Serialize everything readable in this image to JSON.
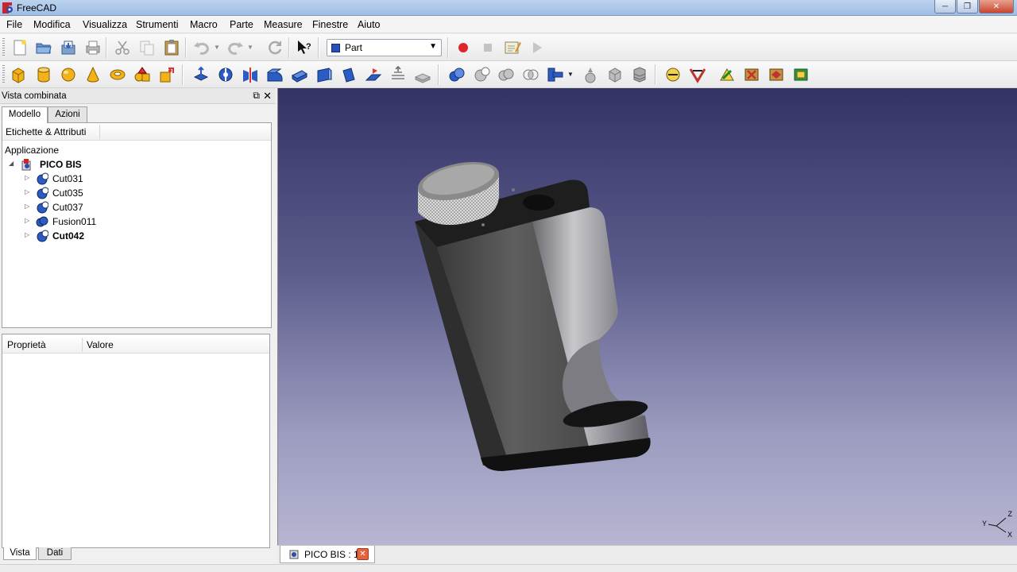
{
  "window": {
    "title": "FreeCAD"
  },
  "menu": [
    "File",
    "Modifica",
    "Visualizza",
    "Strumenti",
    "Macro",
    "Parte",
    "Measure",
    "Finestre",
    "Aiuto"
  ],
  "toolbar": {
    "workbench_selected": "Part"
  },
  "dock": {
    "title": "Vista combinata",
    "tabs": [
      "Modello",
      "Azioni"
    ],
    "tree_header": "Etichette & Attributi",
    "root_label": "Applicazione",
    "document": "PICO BIS",
    "objects": [
      {
        "label": "Cut031",
        "bold": false
      },
      {
        "label": "Cut035",
        "bold": false
      },
      {
        "label": "Cut037",
        "bold": false
      },
      {
        "label": "Fusion011",
        "bold": false
      },
      {
        "label": "Cut042",
        "bold": true
      }
    ],
    "property_columns": [
      "Proprietà",
      "Valore"
    ],
    "bottom_tabs": [
      "Vista",
      "Dati"
    ]
  },
  "view": {
    "axis_labels": {
      "x": "X",
      "y": "Y",
      "z": "Z"
    }
  },
  "document_tab": {
    "label": "PICO BIS : 1"
  },
  "colors": {
    "view_top": "#333366",
    "view_bottom": "#b6b6d2",
    "model_body": "#4a4a4a",
    "accent_close": "#e2633e"
  }
}
